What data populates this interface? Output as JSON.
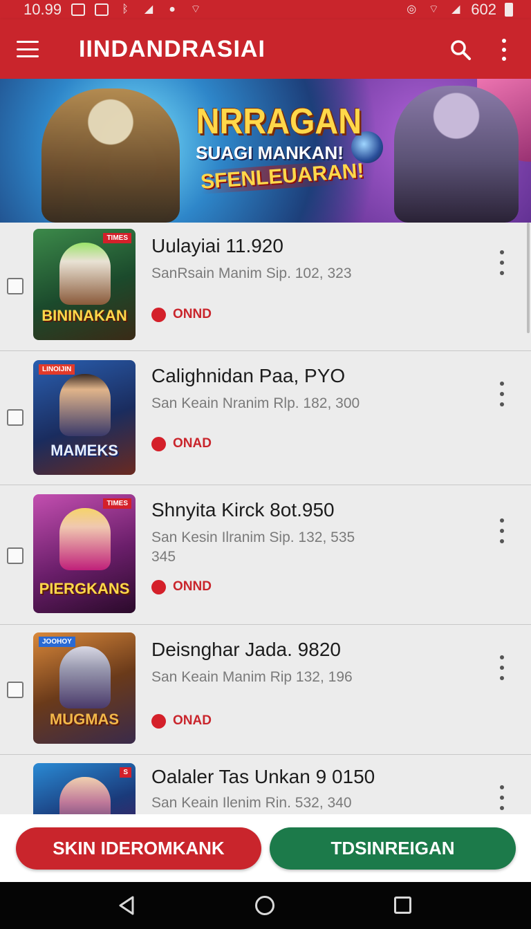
{
  "status_bar": {
    "time": "10.99",
    "battery": "602",
    "icons": [
      "image-icon",
      "screenshot-icon",
      "bluetooth-icon",
      "signal-icon",
      "notification-icon",
      "wifi-icon",
      "alarm-icon",
      "wifi-icon",
      "signal-icon",
      "battery-icon"
    ]
  },
  "app_bar": {
    "title": "IINDANDRASIAI",
    "icons": [
      "menu-icon",
      "search-icon",
      "more-vert-icon"
    ]
  },
  "banner": {
    "line1": "NRRAGAN",
    "line2": "SUAGI MANKAN!",
    "line3": "SFENLEUARAN!"
  },
  "games": [
    {
      "title": "Uulayiai 11.920",
      "subtitle": "SanRsain Manim Sip. 102, 323",
      "status": "ONND",
      "thumb_caption": "BININAKAN",
      "tag": "TIMES"
    },
    {
      "title": "Calighnidan Paa, PYO",
      "subtitle": "San Keain Nranim Rlp. 182, 300",
      "status": "ONAD",
      "thumb_caption": "MAMEKS",
      "tag": "LINOIJIN"
    },
    {
      "title": "Shnyita Kirck 8ot.950",
      "subtitle": "San Kesin Ilranim Sip. 132, 535\n345",
      "status": "ONND",
      "thumb_caption": "PIERGKANS",
      "tag": "TIMES"
    },
    {
      "title": "Deisnghar Jada. 9820",
      "subtitle": "San Keain Manim Rip 132, 196",
      "status": "ONAD",
      "thumb_caption": "MUGMAS",
      "tag": "JOOHOY"
    },
    {
      "title": "Oalaler Tas Unkan 9 0150",
      "subtitle": "San Keain Ilenim Rin. 532, 340",
      "status": "",
      "thumb_caption": "",
      "tag": "S"
    }
  ],
  "buttons": {
    "primary": "SKIN IDEROMKANK",
    "secondary": "TDSINREIGAN"
  },
  "colors": {
    "brand_red": "#c9252c",
    "action_green": "#1c7a4a"
  }
}
